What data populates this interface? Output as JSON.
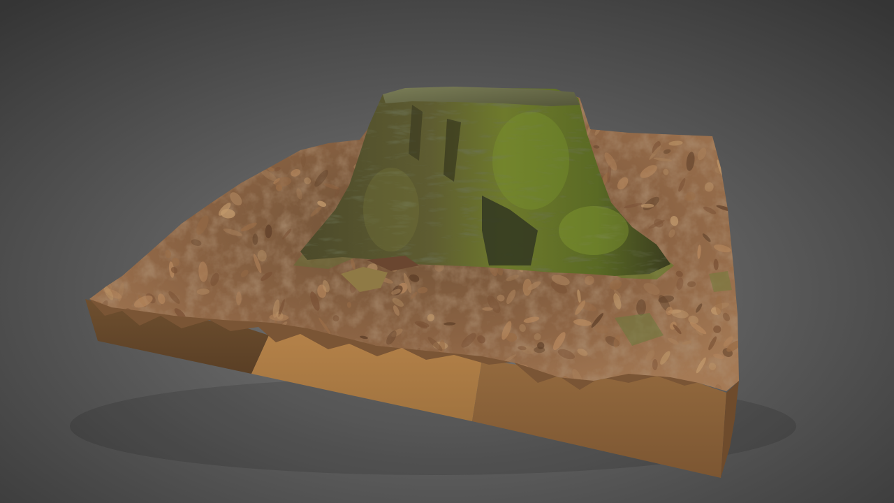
{
  "scene": {
    "subject": "tree-stump-terrain-model",
    "colors": {
      "background_center": "#7c7c7c",
      "background_edge": "#353535",
      "leaf_litter_light": "#a2744f",
      "leaf_litter_mid": "#8a6242",
      "leaf_litter_dark": "#5c3f2a",
      "stump_bark": "#5a5a2f",
      "stump_moss": "#6f8a2a",
      "stump_shadow": "#2c2f1c",
      "stump_top": "#6b6e4a",
      "base_front_left": "#7d5a35",
      "base_front_mid": "#b07f47",
      "base_front_right": "#8e663c",
      "base_right_side": "#7a5432"
    }
  }
}
